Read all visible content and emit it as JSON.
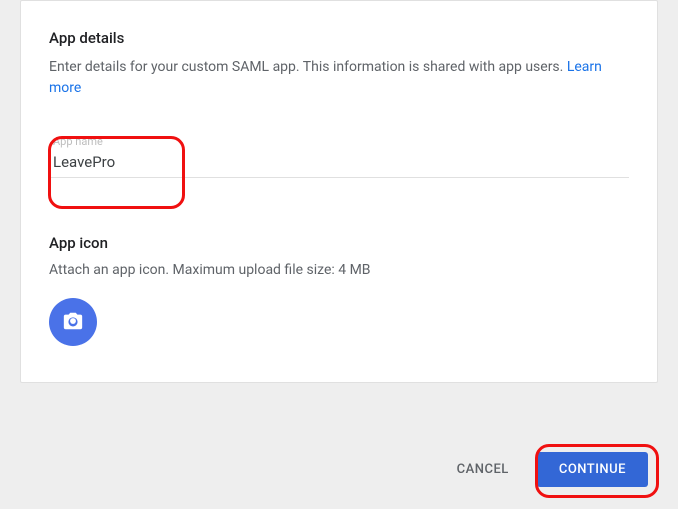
{
  "appDetails": {
    "title": "App details",
    "description": "Enter details for your custom SAML app. This information is shared with app users. ",
    "learnMore": "Learn more",
    "fieldLabel": "App name",
    "fieldValue": "LeavePro"
  },
  "appIcon": {
    "title": "App icon",
    "description": "Attach an app icon. Maximum upload file size: 4 MB"
  },
  "footer": {
    "cancel": "CANCEL",
    "continue": "CONTINUE"
  }
}
